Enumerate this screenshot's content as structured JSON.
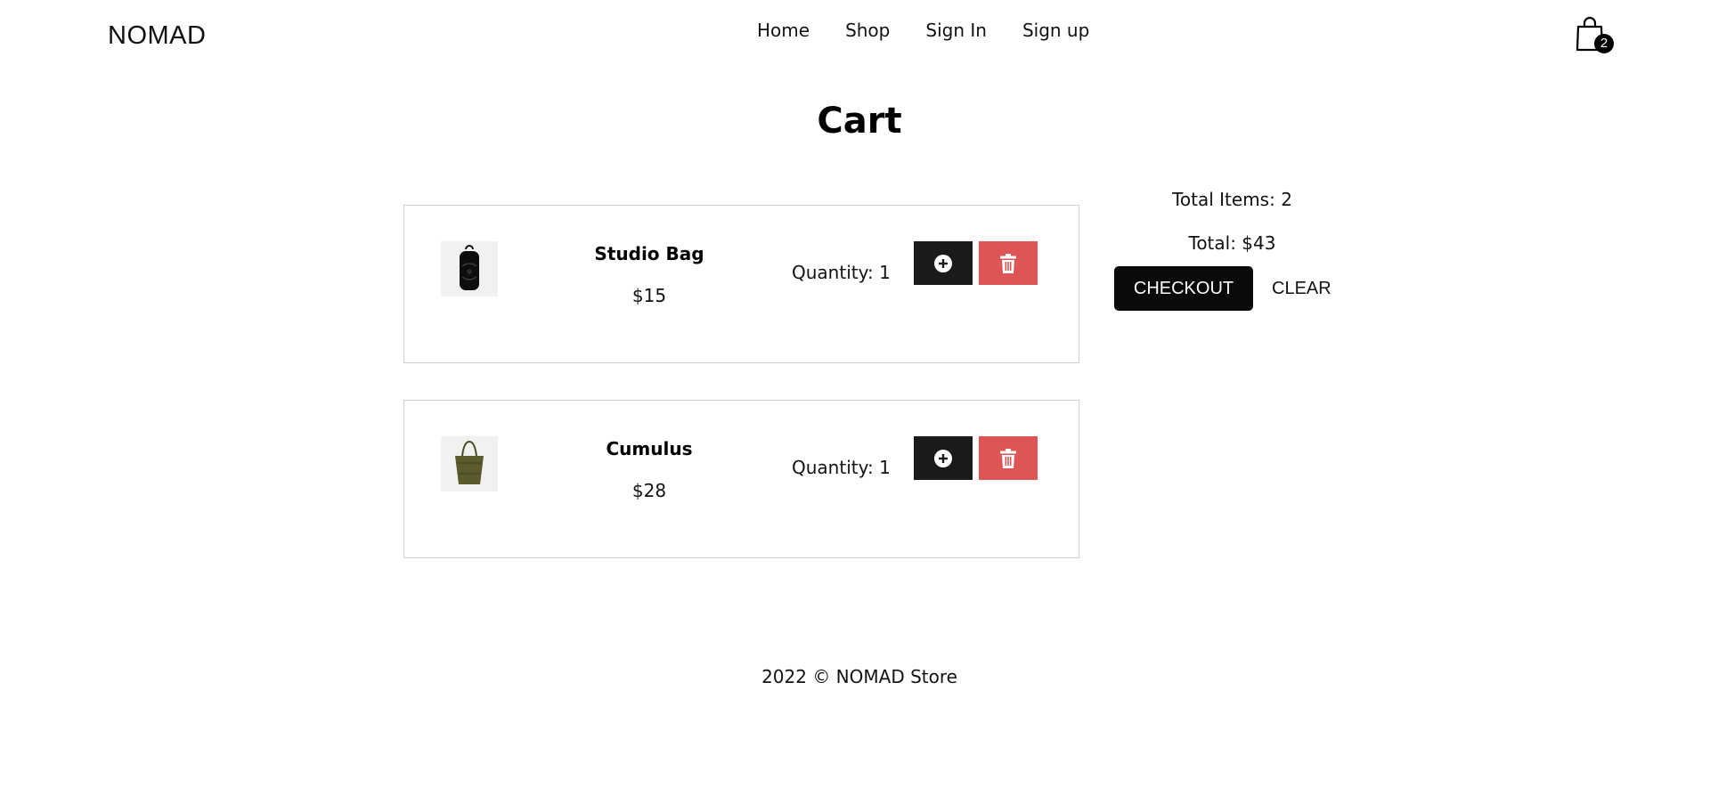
{
  "header": {
    "brand": "NOMAD",
    "nav": [
      {
        "label": "Home"
      },
      {
        "label": "Shop"
      },
      {
        "label": "Sign In"
      },
      {
        "label": "Sign up"
      }
    ],
    "cart_count": "2"
  },
  "page": {
    "title": "Cart"
  },
  "cart": {
    "items": [
      {
        "name": "Studio Bag",
        "price": "$15",
        "quantity": "Quantity: 1",
        "image_icon": "backpack-icon"
      },
      {
        "name": "Cumulus",
        "price": "$28",
        "quantity": "Quantity: 1",
        "image_icon": "tote-bag-icon"
      }
    ]
  },
  "summary": {
    "total_items": "Total Items: 2",
    "total": "Total: $43",
    "checkout_label": "CHECKOUT",
    "clear_label": "CLEAR"
  },
  "footer": {
    "text": "2022 © NOMAD Store"
  },
  "colors": {
    "add_button": "#1a1a1a",
    "delete_button": "#dd5555",
    "checkout_button": "#0a0a0a",
    "item_border": "#cfcfcf"
  }
}
